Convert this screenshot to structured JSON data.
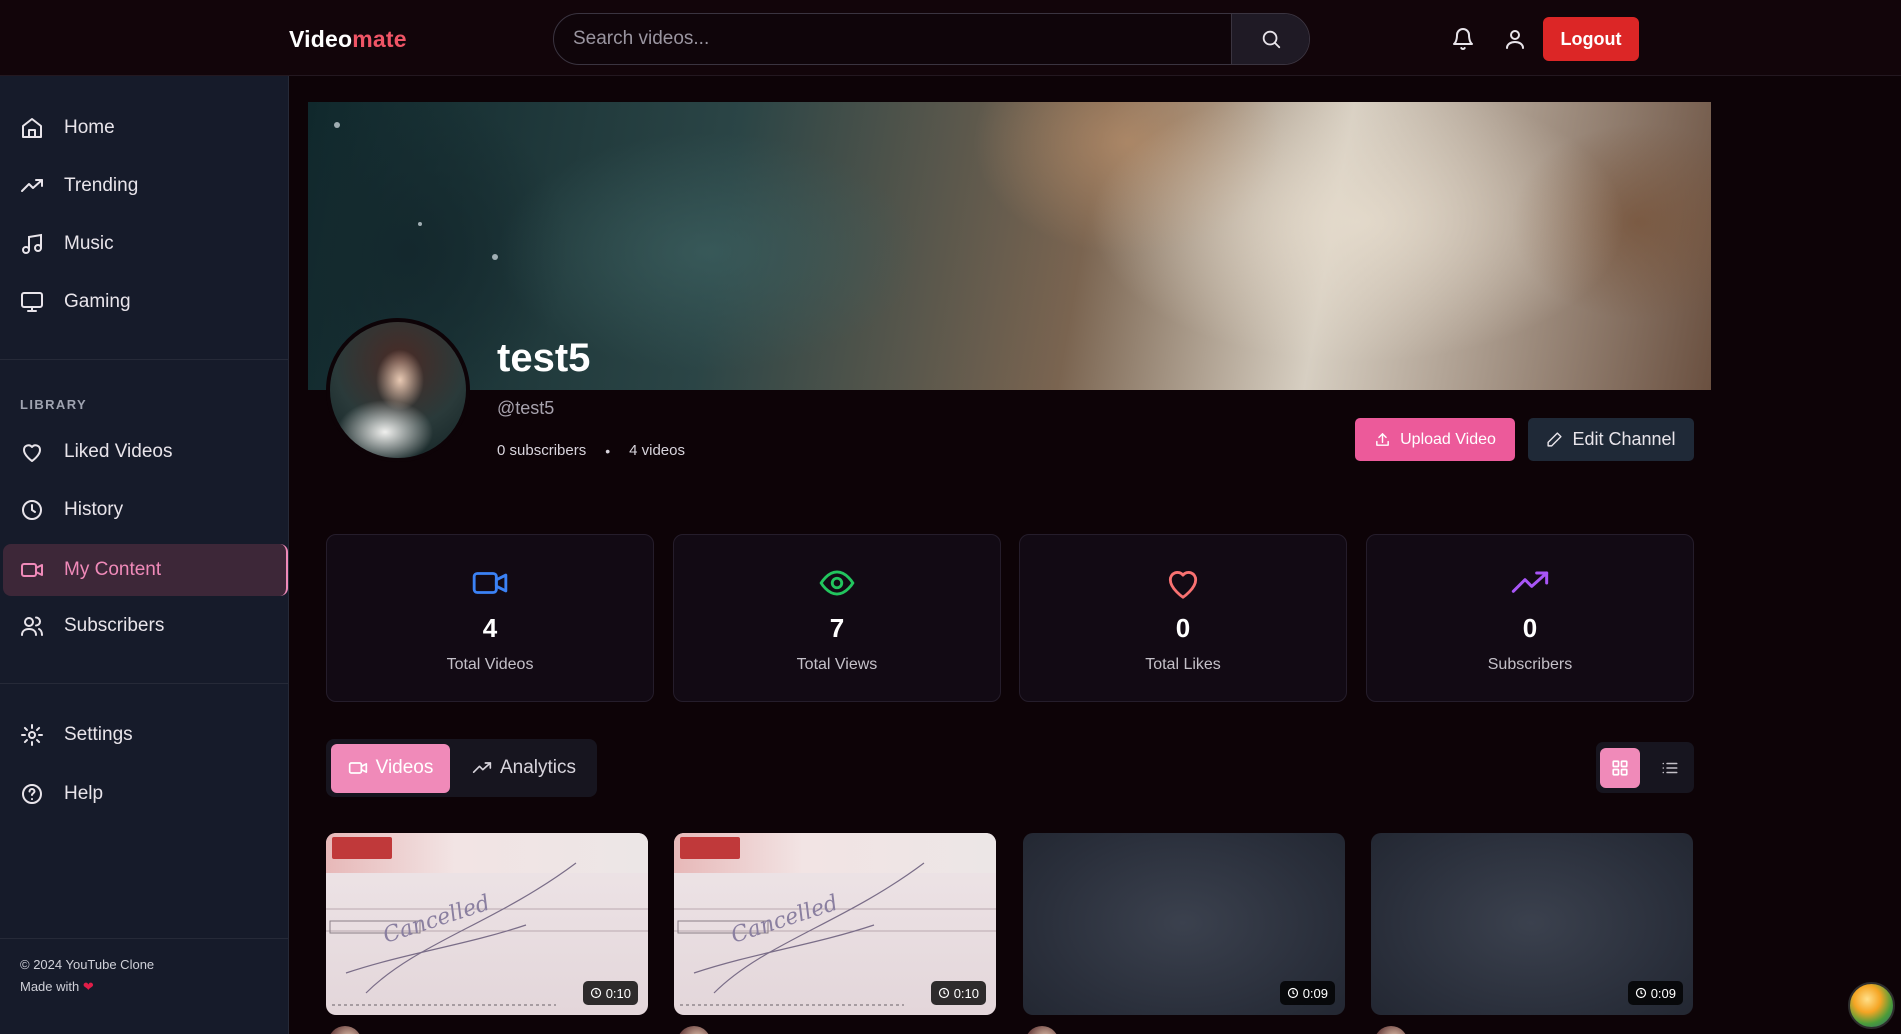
{
  "header": {
    "logo_main": "Video",
    "logo_accent": "mate",
    "search_placeholder": "Search videos...",
    "logout_label": "Logout"
  },
  "sidebar": {
    "items": [
      {
        "label": "Home",
        "icon": "home-icon"
      },
      {
        "label": "Trending",
        "icon": "trending-icon"
      },
      {
        "label": "Music",
        "icon": "music-icon"
      },
      {
        "label": "Gaming",
        "icon": "monitor-icon"
      }
    ],
    "library_title": "LIBRARY",
    "library_items": [
      {
        "label": "Liked Videos",
        "icon": "heart-icon"
      },
      {
        "label": "History",
        "icon": "clock-icon"
      },
      {
        "label": "My Content",
        "icon": "video-icon",
        "active": true
      },
      {
        "label": "Subscribers",
        "icon": "users-icon"
      }
    ],
    "bottom_items": [
      {
        "label": "Settings",
        "icon": "gear-icon"
      },
      {
        "label": "Help",
        "icon": "help-icon"
      }
    ],
    "footer_copyright": "© 2024 YouTube Clone",
    "footer_made_with": "Made with"
  },
  "channel": {
    "name": "test5",
    "handle": "@test5",
    "subscribers_text": "0 subscribers",
    "videos_text": "4 videos",
    "upload_label": "Upload Video",
    "edit_label": "Edit Channel"
  },
  "stats": [
    {
      "value": "4",
      "label": "Total Videos",
      "icon": "video-icon",
      "color": "#3b82f6"
    },
    {
      "value": "7",
      "label": "Total Views",
      "icon": "eye-icon",
      "color": "#22c55e"
    },
    {
      "value": "0",
      "label": "Total Likes",
      "icon": "heart-icon",
      "color": "#f87171"
    },
    {
      "value": "0",
      "label": "Subscribers",
      "icon": "trending-icon",
      "color": "#a855f7"
    }
  ],
  "tabs": [
    {
      "label": "Videos",
      "active": true
    },
    {
      "label": "Analytics",
      "active": false
    }
  ],
  "videos": [
    {
      "duration": "0:10",
      "thumbnail": "cheque"
    },
    {
      "duration": "0:10",
      "thumbnail": "cheque"
    },
    {
      "duration": "0:09",
      "thumbnail": "blank"
    },
    {
      "duration": "0:09",
      "thumbnail": "blank"
    }
  ],
  "colors": {
    "accent_pink": "#f08ab9",
    "logout_red": "#dc2626",
    "upload_pink": "#ec5a9a"
  }
}
